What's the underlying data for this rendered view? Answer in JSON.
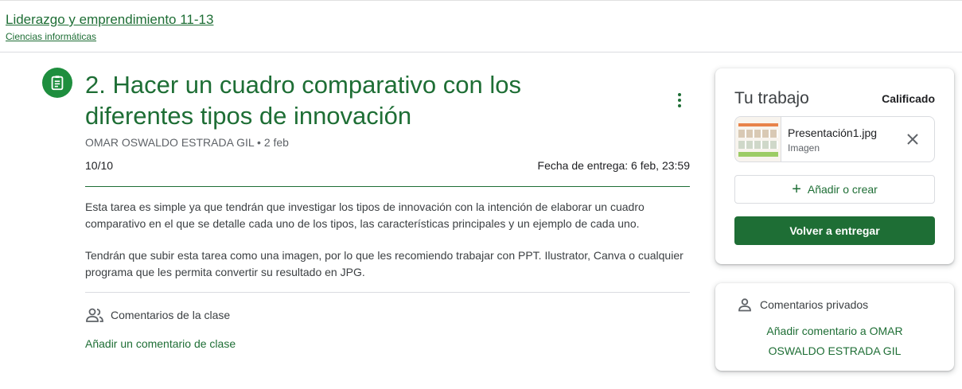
{
  "header": {
    "class_title": "Liderazgo y emprendimiento 11-13",
    "class_subtitle": "Ciencias informáticas"
  },
  "assignment": {
    "icon": "assignment-icon",
    "title": "2. Hacer un cuadro comparativo con los diferentes tipos de innovación",
    "author": "OMAR OSWALDO ESTRADA GIL",
    "date": "2 feb",
    "grade": "10/10",
    "due": "Fecha de entrega: 6 feb, 23:59",
    "description": [
      "Esta tarea es simple ya que tendrán que investigar los tipos de innovación con la intención de elaborar un cuadro comparativo en el que se detalle cada uno de los tipos, las características principales y un ejemplo de cada uno.",
      "Tendrán que subir esta tarea como una imagen, por lo que les recomiendo trabajar con PPT. Ilustrator, Canva o cualquier programa que les permita convertir su resultado en JPG."
    ],
    "class_comments_label": "Comentarios de la clase",
    "add_class_comment": "Añadir un comentario de clase"
  },
  "work": {
    "title": "Tu trabajo",
    "status": "Calificado",
    "attachment": {
      "name": "Presentación1.jpg",
      "type": "Imagen"
    },
    "add_or_create": "Añadir o crear",
    "resubmit": "Volver a entregar"
  },
  "private_comments": {
    "label": "Comentarios privados",
    "add": "Añadir comentario a OMAR OSWALDO ESTRADA GIL"
  },
  "colors": {
    "accent": "#1e6e35",
    "icon_bg": "#1e8e3e"
  }
}
